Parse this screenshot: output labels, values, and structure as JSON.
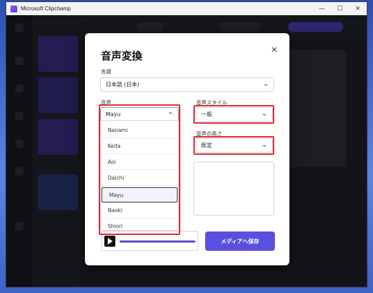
{
  "window": {
    "app_title": "Microsoft Clipchamp",
    "controls": [
      "—",
      "☐",
      "✕"
    ]
  },
  "modal": {
    "title": "音声変換",
    "close_label": "✕",
    "language": {
      "label": "言語",
      "value": "日本語 (日本)"
    },
    "voice": {
      "label": "音声",
      "value": "Mayu",
      "options": [
        "Nanami",
        "Keita",
        "Aoi",
        "Daichi",
        "Mayu",
        "Naoki",
        "Shiori"
      ],
      "selected_index": 4
    },
    "voice_style": {
      "label": "音声スタイル",
      "value": "一般"
    },
    "pitch": {
      "label": "音声の高さ",
      "value": "既定"
    },
    "save_label": "メディアへ保存"
  },
  "colors": {
    "accent": "#5b4fe0",
    "highlight_box": "#e3262f"
  },
  "icons": {
    "chevron": "chevron-down-icon",
    "chevron_up": "chevron-up-icon",
    "play": "play-icon",
    "close": "close-icon"
  }
}
